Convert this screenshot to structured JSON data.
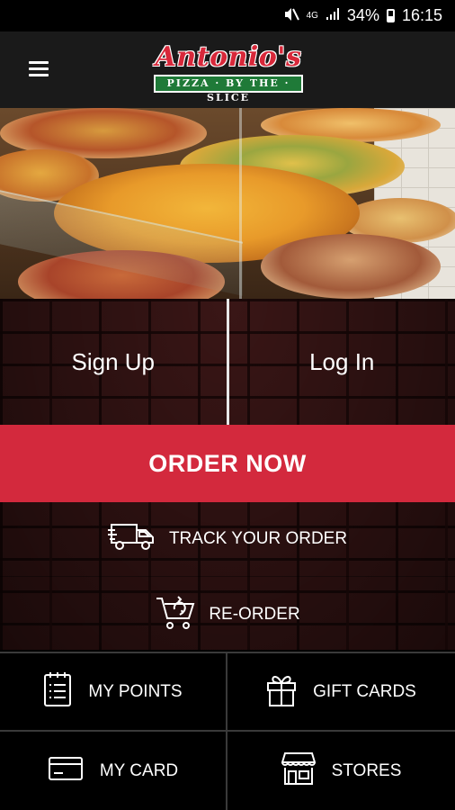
{
  "status_bar": {
    "battery": "34%",
    "time": "16:15",
    "network": "4G"
  },
  "app_bar": {
    "logo_script": "Antonio's",
    "logo_band": "PIZZA · BY THE · SLICE"
  },
  "auth": {
    "signup_label": "Sign Up",
    "login_label": "Log In"
  },
  "order_now_label": "ORDER NOW",
  "track_label": "TRACK YOUR ORDER",
  "reorder_label": "RE-ORDER",
  "tiles": [
    {
      "label": "MY POINTS",
      "icon": "points-list-icon"
    },
    {
      "label": "GIFT CARDS",
      "icon": "gift-icon"
    },
    {
      "label": "MY CARD",
      "icon": "credit-card-icon"
    },
    {
      "label": "STORES",
      "icon": "storefront-icon"
    }
  ],
  "colors": {
    "accent_red": "#d3293d",
    "logo_green": "#1f7a38",
    "bar_bg": "#1a1a1a"
  }
}
